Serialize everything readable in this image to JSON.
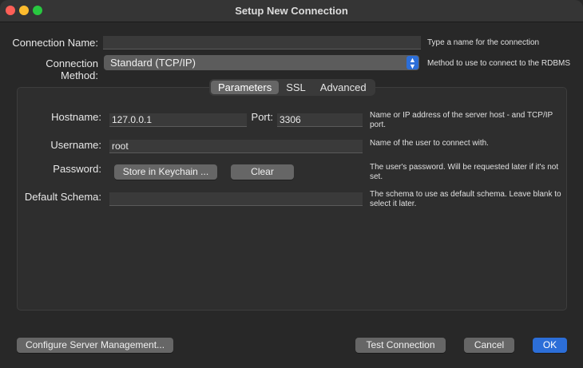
{
  "window": {
    "title": "Setup New Connection"
  },
  "connection_name": {
    "label": "Connection Name:",
    "value": "",
    "hint": "Type a name for the connection"
  },
  "connection_method": {
    "label": "Connection Method:",
    "value": "Standard (TCP/IP)",
    "hint": "Method to use to connect to the RDBMS"
  },
  "tabs": [
    "Parameters",
    "SSL",
    "Advanced"
  ],
  "active_tab": "Parameters",
  "params": {
    "hostname": {
      "label": "Hostname:",
      "value": "127.0.0.1"
    },
    "port": {
      "label": "Port:",
      "value": "3306"
    },
    "hostname_hint": "Name or IP address of the server host - and TCP/IP port.",
    "username": {
      "label": "Username:",
      "value": "root",
      "hint": "Name of the user to connect with."
    },
    "password": {
      "label": "Password:",
      "store_button": "Store in Keychain ...",
      "clear_button": "Clear",
      "hint": "The user's password. Will be requested later if it's not set."
    },
    "default_schema": {
      "label": "Default Schema:",
      "value": "",
      "hint": "The schema to use as default schema. Leave blank to select it later."
    }
  },
  "footer": {
    "configure_button": "Configure Server Management...",
    "test_button": "Test Connection",
    "cancel_button": "Cancel",
    "ok_button": "OK"
  },
  "colors": {
    "accent": "#2c6ed8",
    "background": "#282828",
    "close": "#ff5f57",
    "minimize": "#febc2e",
    "maximize": "#28c840"
  },
  "icons": {
    "select_arrows": "updown-chevron-icon"
  }
}
